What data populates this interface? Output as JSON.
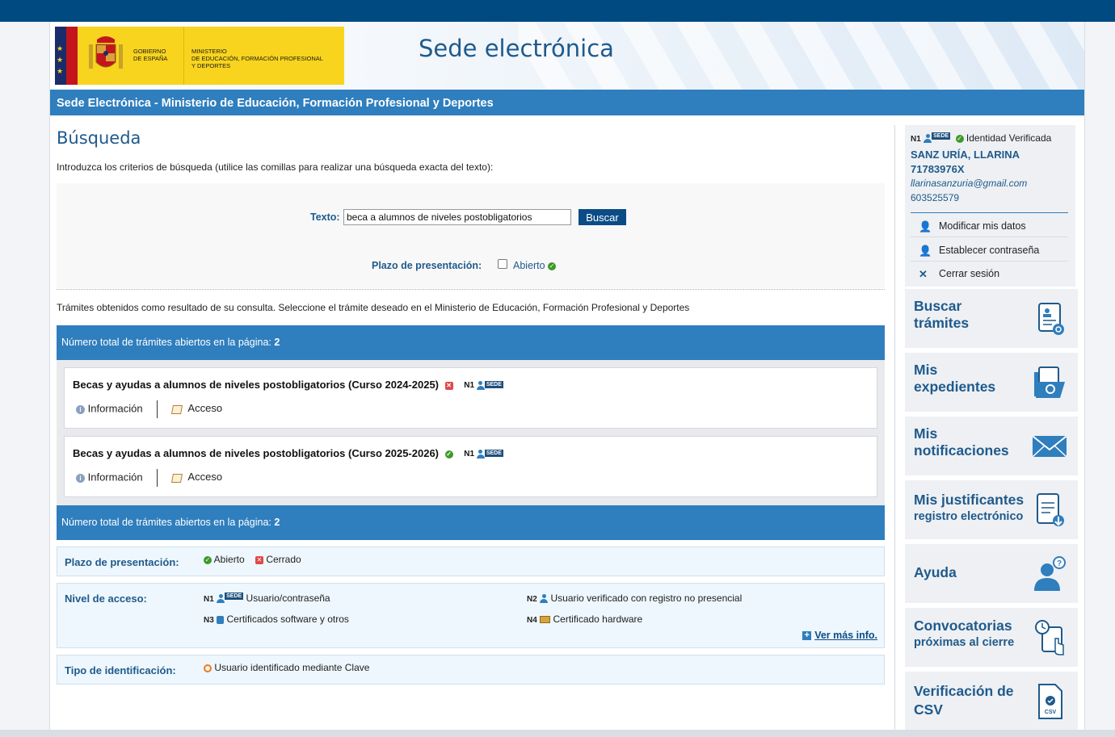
{
  "header": {
    "logo_gobierno": "GOBIERNO\nDE ESPAÑA",
    "logo_ministerio": "MINISTERIO\nDE EDUCACIÓN, FORMACIÓN PROFESIONAL\nY DEPORTES",
    "site_title": "Sede electrónica"
  },
  "bluebar": {
    "title": "Sede Electrónica - Ministerio de Educación, Formación Profesional y Deportes"
  },
  "search": {
    "heading": "Búsqueda",
    "intro": "Introduzca los criterios de búsqueda (utilice las comillas para realizar una búsqueda exacta del texto):",
    "text_label": "Texto:",
    "text_value": "beca a alumnos de niveles postobligatorios",
    "button_label": "Buscar",
    "plazo_label": "Plazo de presentación:",
    "plazo_option": "Abierto"
  },
  "results": {
    "intro": "Trámites obtenidos como resultado de su consulta. Seleccione el trámite deseado en el Ministerio de Educación, Formación Profesional y Deportes",
    "total_label": "Número total de trámites abiertos en la página:",
    "total_value": "2",
    "items": [
      {
        "title": "Becas y ayudas a alumnos de niveles postobligatorios (Curso 2024-2025)",
        "status": "cerrado",
        "level": "N1",
        "badge": "SEDE",
        "info_label": "Información",
        "access_label": "Acceso"
      },
      {
        "title": "Becas y ayudas a alumnos de niveles postobligatorios (Curso 2025-2026)",
        "status": "abierto",
        "level": "N1",
        "badge": "SEDE",
        "info_label": "Información",
        "access_label": "Acceso"
      }
    ]
  },
  "legend": {
    "plazo_label": "Plazo de presentación:",
    "plazo_abierto": "Abierto",
    "plazo_cerrado": "Cerrado",
    "nivel_label": "Nivel de acceso:",
    "n1_code": "N1",
    "n1_badge": "SEDE",
    "n1_text": "Usuario/contraseña",
    "n2_code": "N2",
    "n2_text": "Usuario verificado con registro no presencial",
    "n3_code": "N3",
    "n3_text": "Certificados software y otros",
    "n4_code": "N4",
    "n4_text": "Certificado hardware",
    "more_info": "Ver más info.",
    "tipo_label": "Tipo de identificación:",
    "tipo_text": "Usuario identificado mediante Clave"
  },
  "user": {
    "level": "N1",
    "badge": "SEDE",
    "verified": "Identidad Verificada",
    "name": "SANZ URÍA, LLARINA",
    "id": "71783976X",
    "email": "llarinasanzuria@gmail.com",
    "phone": "603525579",
    "actions": [
      "Modificar mis datos",
      "Establecer contraseña",
      "Cerrar sesión"
    ]
  },
  "tiles": [
    {
      "line1": "Buscar",
      "line2": "trámites",
      "icon": "search-document-icon"
    },
    {
      "line1": "Mis",
      "line2": "expedientes",
      "icon": "folder-search-icon"
    },
    {
      "line1": "Mis",
      "line2": "notificaciones",
      "icon": "envelope-icon"
    },
    {
      "line1": "Mis justificantes",
      "line2": "registro electrónico",
      "icon": "document-download-icon"
    },
    {
      "line1": "Ayuda",
      "line2": "",
      "icon": "help-user-icon"
    },
    {
      "line1": "Convocatorias",
      "line2": "próximas al cierre",
      "icon": "clock-document-icon"
    },
    {
      "line1": "Verificación de",
      "line2": "CSV",
      "icon": "csv-document-icon"
    }
  ],
  "colors": {
    "primary_blue": "#2f7ebe",
    "dark_blue": "#004a82",
    "title_blue": "#1f5a8c",
    "open_green": "#3d9a2a",
    "closed_red": "#e04848"
  }
}
